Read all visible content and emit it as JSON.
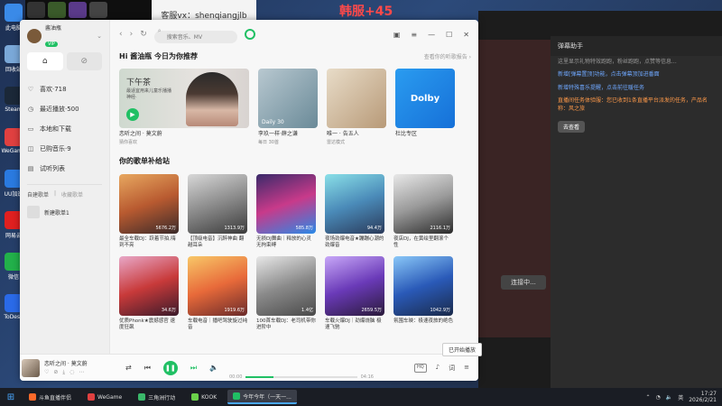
{
  "overlay": {
    "wechat_note": "客服vx：shenqiangjlb",
    "title_overlay": "韩服+45"
  },
  "desktop_icons": [
    {
      "label": "此电脑",
      "color": "#3a8ae8"
    },
    {
      "label": "回收站",
      "color": "#7aa8d8"
    },
    {
      "label": "Steam",
      "color": "#1b2838"
    },
    {
      "label": "WeGame",
      "color": "#e04040"
    },
    {
      "label": "UU加速",
      "color": "#2a7ae0"
    },
    {
      "label": "网易云",
      "color": "#e02020"
    },
    {
      "label": "微信",
      "color": "#22b04a"
    },
    {
      "label": "ToDesk",
      "color": "#2a6ae8"
    }
  ],
  "sidebar": {
    "username": "酱油瓶",
    "vip": "VIP",
    "tabs": [
      "⌂",
      "⊘"
    ],
    "items": [
      {
        "icon": "♡",
        "label": "喜欢·718"
      },
      {
        "icon": "◷",
        "label": "最近播放·500"
      },
      {
        "icon": "▭",
        "label": "本地和下载"
      },
      {
        "icon": "◫",
        "label": "已购音乐·9"
      },
      {
        "icon": "▤",
        "label": "试听列表"
      }
    ],
    "playlist_tabs": {
      "created": "自建歌单",
      "separator": "|",
      "collected": "收藏歌单"
    },
    "new_playlist": "新建歌单1"
  },
  "topbar": {
    "search_placeholder": "搜索音乐、MV",
    "win_controls": [
      "▣",
      "≡",
      "—",
      "☐",
      "✕"
    ]
  },
  "recommend": {
    "title": "Hi 酱油瓶 今日为你推荐",
    "more": "查看你的听歌报告 ›",
    "big": {
      "line1": "下午茶",
      "line2": "最适宜用来儿童乐播播神经·",
      "caption": "恋听之间 · 莫文蔚",
      "sub": "猜你喜欢"
    },
    "small": [
      {
        "label": "Daily 30",
        "caption": "李玖一样·薛之谦",
        "sub": "每日 30首",
        "bg": "linear-gradient(135deg,#b8c8d0,#6a8a98)"
      },
      {
        "label": "",
        "caption": "唯一 · 告五人",
        "sub": "雷达模式",
        "bg": "linear-gradient(135deg,#e8dcc8,#b89a78)"
      },
      {
        "label": "Dolby",
        "caption": "杜比专区",
        "sub": "",
        "bg": ""
      }
    ]
  },
  "playlists": {
    "title": "你的歌单补给站",
    "cards": [
      {
        "plays": "5676.2万",
        "caption": "最全车载DJ：跃着节拍,嗨到不亮",
        "bg": "linear-gradient(160deg,#e8a860,#b85a30,#3a2a2a)"
      },
      {
        "plays": "1313.9万",
        "caption": "【顶级电音】沉醉神曲 翻越耳朵",
        "bg": "linear-gradient(160deg,#d8d8d8,#8a8a8a,#3a3a3a)"
      },
      {
        "plays": "585.8万",
        "caption": "无损DJ舞曲｜释放的心灵无拘束缚",
        "bg": "linear-gradient(160deg,#3a2a6a,#c83a8a,#2a8ae8)"
      },
      {
        "plays": "94.4万",
        "caption": "夜场劲爆电音★蹦蹦心潮的劲爆音",
        "bg": "linear-gradient(160deg,#8ae0e8,#4a8ab8,#2a3a5a)"
      },
      {
        "plays": "2116.1万",
        "caption": "夜店DJ，在黄绘里翻滚个性",
        "bg": "linear-gradient(160deg,#e8e8e8,#9a9a9a,#2a2a2a)"
      },
      {
        "plays": "34.6万",
        "caption": "优质Phonk★震撼感官 速度狂飙",
        "bg": "linear-gradient(160deg,#e8a8c8,#c83a3a,#3a1a2a)"
      },
      {
        "plays": "1919.6万",
        "caption": "车载电音｜播吧驾驶旋过纯音",
        "bg": "linear-gradient(160deg,#f8c868,#e86a3a,#6a2a2a)"
      },
      {
        "plays": "1.4亿",
        "caption": "100首车载DJ：老司机带你进阶中",
        "bg": "linear-gradient(160deg,#e8e8e8,#8a8a8a,#4a4a4a)"
      },
      {
        "plays": "2659.5万",
        "caption": "车载火爆DJ｜劲爆烧脑 极速飞驰",
        "bg": "linear-gradient(160deg,#c8a8f8,#6a3ab8,#2a1a3a)"
      },
      {
        "plays": "1042.9万",
        "caption": "氛围车映：极速夜旅的绝色",
        "bg": "linear-gradient(160deg,#8ac8f8,#2a5ab8,#1a2a4a)"
      }
    ]
  },
  "player": {
    "title": "恋听之间 · 莫文蔚",
    "time_current": "00:00",
    "time_total": "04:16",
    "progress": 0.25,
    "quality": "HQ",
    "tooltip": "已开始播放"
  },
  "bg_app": {
    "tabs": [
      "弹幕助手",
      "",
      ""
    ],
    "lines": [
      "这里显示礼物特效跑跑，粉丝跑跑，点赞等信息...",
      "新增[弹幕置顶]功能，点击弹幕顶加进番面",
      "新增特殊喜乐提醒，点击前往暖任务",
      "直播间任务体验服：您已收到1条直播平台派发的任务，产品名称：风之旅",
      "去查看"
    ],
    "connecting": "连接中..."
  },
  "taskbar": {
    "apps": [
      {
        "label": "斗鱼直播伴侣",
        "color": "#ff6a2a",
        "active": false
      },
      {
        "label": "WeGame",
        "color": "#e04040",
        "active": false
      },
      {
        "label": "三角洲行动",
        "color": "#3ab86a",
        "active": false
      },
      {
        "label": "KOOK",
        "color": "#6ad04a",
        "active": false
      },
      {
        "label": "今年今年（一天一...",
        "color": "#20c064",
        "active": true
      }
    ],
    "tray_lang": "英",
    "time": "17:27",
    "date": "2026/2/21"
  }
}
